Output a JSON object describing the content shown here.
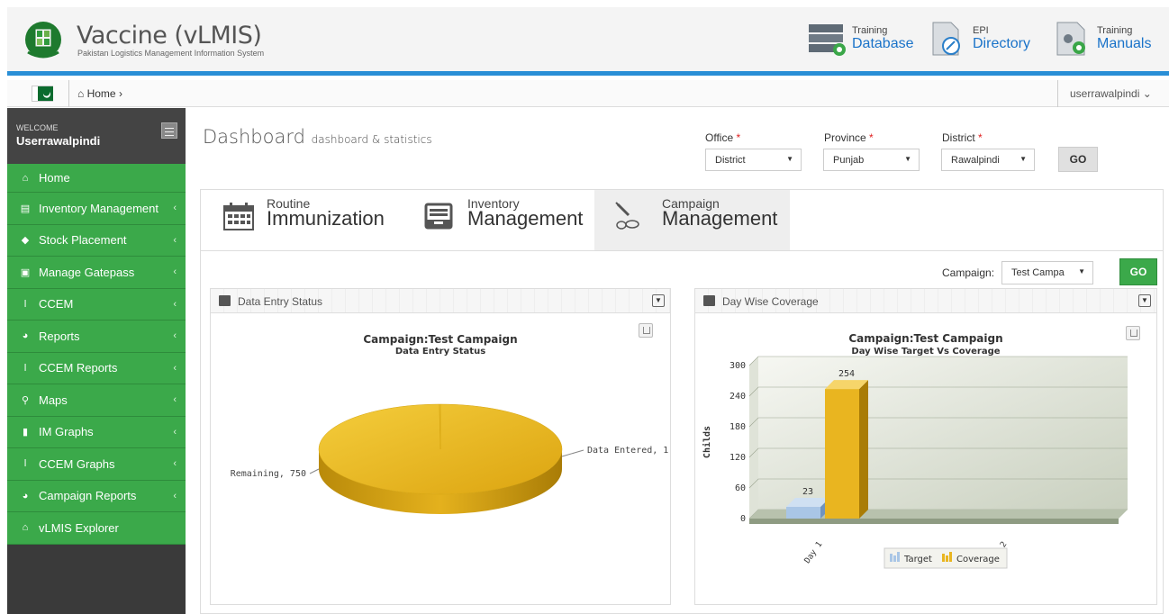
{
  "header": {
    "title": "Vaccine (vLMIS)",
    "subtitle": "Pakistan Logistics Management Information System",
    "links": [
      {
        "small": "Training",
        "big": "Database",
        "icon": "database-icon"
      },
      {
        "small": "EPI",
        "big": "Directory",
        "icon": "directory-icon"
      },
      {
        "small": "Training",
        "big": "Manuals",
        "icon": "manuals-icon"
      }
    ]
  },
  "breadcrumb": {
    "home": "Home",
    "sep": "›"
  },
  "user": {
    "name": "userrawalpindi",
    "caret": "⌄"
  },
  "sidebar": {
    "welcome": "WELCOME",
    "username": "Userrawalpindi",
    "items": [
      {
        "label": "Home",
        "icon": "home-icon",
        "glyph": "⌂",
        "chev": ""
      },
      {
        "label": "Inventory Management",
        "icon": "inventory-icon",
        "glyph": "▤",
        "chev": "‹"
      },
      {
        "label": "Stock Placement",
        "icon": "stock-icon",
        "glyph": "◆",
        "chev": "‹"
      },
      {
        "label": "Manage Gatepass",
        "icon": "gatepass-icon",
        "glyph": "▣",
        "chev": "‹"
      },
      {
        "label": "CCEM",
        "icon": "thermometer-icon",
        "glyph": "ǀ",
        "chev": "‹"
      },
      {
        "label": "Reports",
        "icon": "pie-icon",
        "glyph": "◕",
        "chev": "‹"
      },
      {
        "label": "CCEM Reports",
        "icon": "thermometer-icon",
        "glyph": "ǀ",
        "chev": "‹"
      },
      {
        "label": "Maps",
        "icon": "map-pin-icon",
        "glyph": "⚲",
        "chev": "‹"
      },
      {
        "label": "IM Graphs",
        "icon": "bar-chart-icon",
        "glyph": "▮",
        "chev": "‹"
      },
      {
        "label": "CCEM Graphs",
        "icon": "thermometer-icon",
        "glyph": "ǀ",
        "chev": "‹"
      },
      {
        "label": "Campaign Reports",
        "icon": "pie-icon",
        "glyph": "◕",
        "chev": "‹"
      },
      {
        "label": "vLMIS Explorer",
        "icon": "home-icon",
        "glyph": "⌂",
        "chev": ""
      }
    ]
  },
  "dashboard": {
    "title": "Dashboard",
    "subtitle": "dashboard & statistics"
  },
  "filters": {
    "office_label": "Office",
    "office_value": "District",
    "province_label": "Province",
    "province_value": "Punjab",
    "district_label": "District",
    "district_value": "Rawalpindi",
    "required": "*",
    "go": "GO"
  },
  "tabs": [
    {
      "small": "Routine",
      "big": "Immunization",
      "icon": "calendar-icon"
    },
    {
      "small": "Inventory",
      "big": "Management",
      "icon": "inventory-icon"
    },
    {
      "small": "Campaign",
      "big": "Management",
      "icon": "syringe-icon"
    }
  ],
  "campaign": {
    "label": "Campaign:",
    "value": "Test Campa",
    "go": "GO"
  },
  "portlets": {
    "left_title": "Data Entry Status",
    "right_title": "Day Wise Coverage"
  },
  "chart_data": [
    {
      "type": "pie",
      "title": "Campaign:Test Campaign",
      "subtitle": "Data Entry Status",
      "slices": [
        {
          "name": "Remaining",
          "value": 750,
          "label": "Remaining, 750"
        },
        {
          "name": "Data Entered",
          "value": 1,
          "label": "Data Entered, 1"
        }
      ],
      "color": "#e9b520"
    },
    {
      "type": "bar",
      "title": "Campaign:Test Campaign",
      "subtitle": "Day Wise Target Vs Coverage",
      "ylabel": "Childs",
      "categories": [
        "Day 1",
        "Day 2"
      ],
      "series": [
        {
          "name": "Target",
          "values": [
            23,
            null
          ],
          "color": "#9fbfe2"
        },
        {
          "name": "Coverage",
          "values": [
            254,
            null
          ],
          "color": "#e9b520"
        }
      ],
      "ylim": [
        0,
        300
      ],
      "yticks": [
        0,
        60,
        120,
        180,
        240,
        300
      ]
    }
  ]
}
